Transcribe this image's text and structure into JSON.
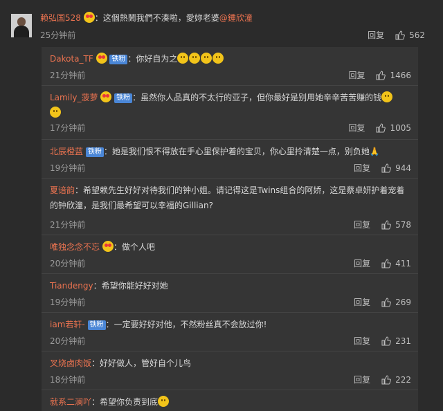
{
  "top": {
    "name": "赖弘国528",
    "text": "这個熱鬧我們不湊啦，愛妳老婆",
    "mention": "@鍾欣潼",
    "time": "25分钟前",
    "reply": "回复",
    "likes": "562"
  },
  "comments": [
    {
      "name": "Dakota_TF",
      "badge": "铁粉",
      "text": "你好自为之",
      "time": "21分钟前",
      "reply": "回复",
      "likes": "1466"
    },
    {
      "name": "Lamily_菠萝",
      "badge": "铁粉",
      "text": "虽然你人品真的不太行的亚子，但你最好是别用她辛辛苦苦赚的钱",
      "time": "17分钟前",
      "reply": "回复",
      "likes": "1005"
    },
    {
      "name": "北辰橙蓝",
      "badge": "铁粉",
      "text": "她是我们恨不得放在手心里保护着的宝贝，你心里拎清楚一点，别负她",
      "time": "19分钟前",
      "reply": "回复",
      "likes": "944"
    },
    {
      "name": "夏谙韵",
      "text": "希望赖先生好好对待我们的钟小姐。请记得这是Twins组合的阿娇，这是蔡卓妍护着宠着的钟欣潼，是我们最希望可以幸福的Gillian?",
      "time": "21分钟前",
      "reply": "回复",
      "likes": "578"
    },
    {
      "name": "唯独念念不忘",
      "text": "做个人吧",
      "time": "20分钟前",
      "reply": "回复",
      "likes": "411"
    },
    {
      "name": "Tiandengy",
      "text": "希望你能好好对她",
      "time": "19分钟前",
      "reply": "回复",
      "likes": "269"
    },
    {
      "name": "iam若轩-",
      "badge": "铁粉",
      "text": "一定要好好对他，不然粉丝真不会放过你!",
      "time": "20分钟前",
      "reply": "回复",
      "likes": "231"
    },
    {
      "name": "叉烧卤肉饭",
      "text": "好好做人，管好自个儿鸟",
      "time": "18分钟前",
      "reply": "回复",
      "likes": "222"
    },
    {
      "name": "就系二澜吖",
      "text": "希望你负责到底"
    }
  ]
}
